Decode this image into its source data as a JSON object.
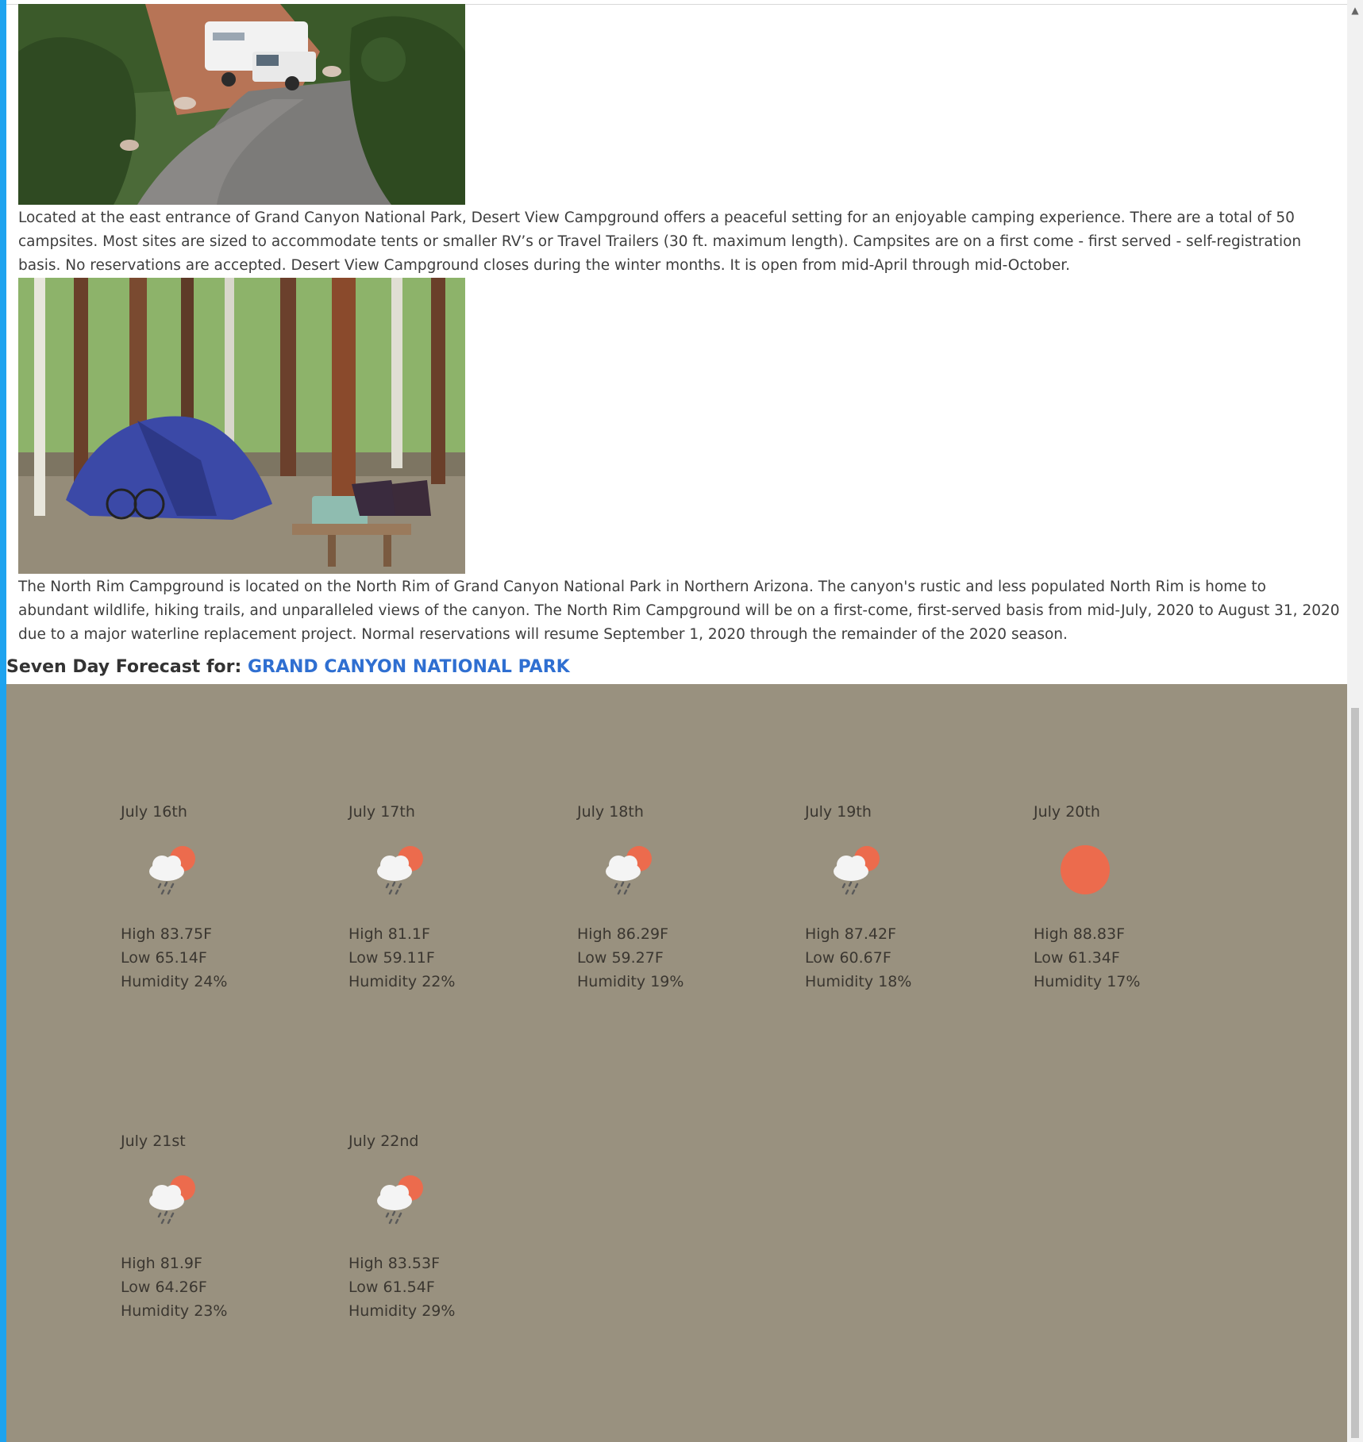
{
  "articles": [
    {
      "image_alt": "RV parked at Desert View Campground",
      "text": "Located at the east entrance of Grand Canyon National Park, Desert View Campground offers a peaceful setting for an enjoyable camping experience. There are a total of 50 campsites. Most sites are sized to accommodate tents or smaller RV’s or Travel Trailers (30 ft. maximum length). Campsites are on a first come - first served - self-registration basis. No reservations are accepted. Desert View Campground closes during the winter months. It is open from mid-April through mid-October."
    },
    {
      "image_alt": "Tent and picnic table at North Rim Campground",
      "text": "The North Rim Campground is located on the North Rim of Grand Canyon National Park in Northern Arizona. The canyon's rustic and less populated North Rim is home to abundant wildlife, hiking trails, and unparalleled views of the canyon. The North Rim Campground will be on a first-come, first-served basis from mid-July, 2020 to August 31, 2020 due to a major waterline replacement project. Normal reservations will resume September 1, 2020 through the remainder of the 2020 season."
    }
  ],
  "forecast": {
    "heading_label": "Seven Day Forecast for:",
    "location": "GRAND CANYON NATIONAL PARK",
    "days": [
      {
        "date": "July 16th",
        "icon": "rain-sun-icon",
        "high": "High 83.75F",
        "low": "Low 65.14F",
        "humidity": "Humidity 24%"
      },
      {
        "date": "July 17th",
        "icon": "rain-sun-icon",
        "high": "High 81.1F",
        "low": "Low 59.11F",
        "humidity": "Humidity 22%"
      },
      {
        "date": "July 18th",
        "icon": "rain-sun-icon",
        "high": "High 86.29F",
        "low": "Low 59.27F",
        "humidity": "Humidity 19%"
      },
      {
        "date": "July 19th",
        "icon": "rain-sun-icon",
        "high": "High 87.42F",
        "low": "Low 60.67F",
        "humidity": "Humidity 18%"
      },
      {
        "date": "July 20th",
        "icon": "sun-icon",
        "high": "High 88.83F",
        "low": "Low 61.34F",
        "humidity": "Humidity 17%"
      },
      {
        "date": "July 21st",
        "icon": "rain-sun-icon",
        "high": "High 81.9F",
        "low": "Low 64.26F",
        "humidity": "Humidity 23%"
      },
      {
        "date": "July 22nd",
        "icon": "rain-sun-icon",
        "high": "High 83.53F",
        "low": "Low 61.54F",
        "humidity": "Humidity 29%"
      }
    ]
  },
  "colors": {
    "panel": "#99917f",
    "link": "#2f6fd1",
    "sun": "#ec6b4d",
    "cloud": "#f4f4f4",
    "rain": "#5a5a5a"
  }
}
